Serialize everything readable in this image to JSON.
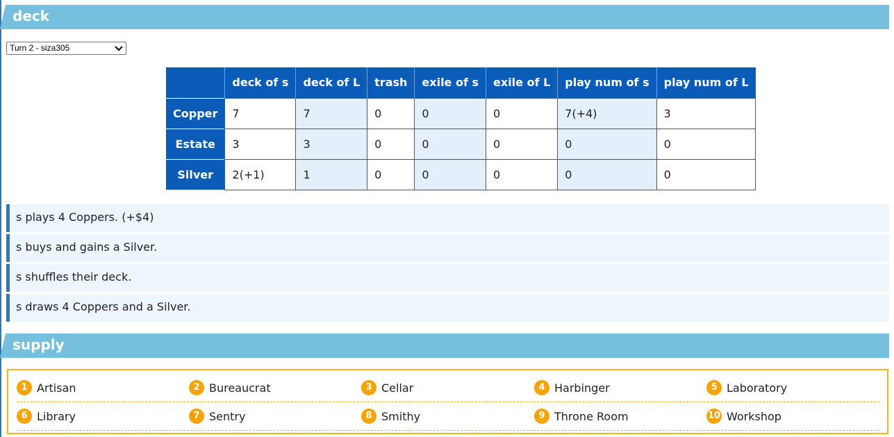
{
  "deck": {
    "heading": "deck",
    "turn_select": {
      "selected": "Turn 2 - siza305"
    },
    "table": {
      "headers": [
        "",
        "deck of s",
        "deck of L",
        "trash",
        "exile of s",
        "exile of L",
        "play num of s",
        "play num of L"
      ],
      "rows": [
        {
          "card": "Copper",
          "cells": [
            "7",
            "7",
            "0",
            "0",
            "0",
            "7(+4)",
            "3"
          ]
        },
        {
          "card": "Estate",
          "cells": [
            "3",
            "3",
            "0",
            "0",
            "0",
            "0",
            "0"
          ]
        },
        {
          "card": "Silver",
          "cells": [
            "2(+1)",
            "1",
            "0",
            "0",
            "0",
            "0",
            "0"
          ]
        }
      ]
    },
    "log": [
      "s plays 4 Coppers. (+$4)",
      "s buys and gains a Silver.",
      "s shuffles their deck.",
      "s draws 4 Coppers and a Silver."
    ]
  },
  "supply": {
    "heading": "supply",
    "cards": [
      {
        "num": "1",
        "name": "Artisan"
      },
      {
        "num": "2",
        "name": "Bureaucrat"
      },
      {
        "num": "3",
        "name": "Cellar"
      },
      {
        "num": "4",
        "name": "Harbinger"
      },
      {
        "num": "5",
        "name": "Laboratory"
      },
      {
        "num": "6",
        "name": "Library"
      },
      {
        "num": "7",
        "name": "Sentry"
      },
      {
        "num": "8",
        "name": "Smithy"
      },
      {
        "num": "9",
        "name": "Throne Room"
      },
      {
        "num": "10",
        "name": "Workshop"
      }
    ]
  },
  "colors": {
    "section_header": "#74c0de",
    "table_header": "#0b5cb8",
    "alt_column": "#e3f0fc",
    "log_background": "#eef6fd",
    "log_accent": "#2a7ab8",
    "supply_accent": "#f5b51a"
  }
}
